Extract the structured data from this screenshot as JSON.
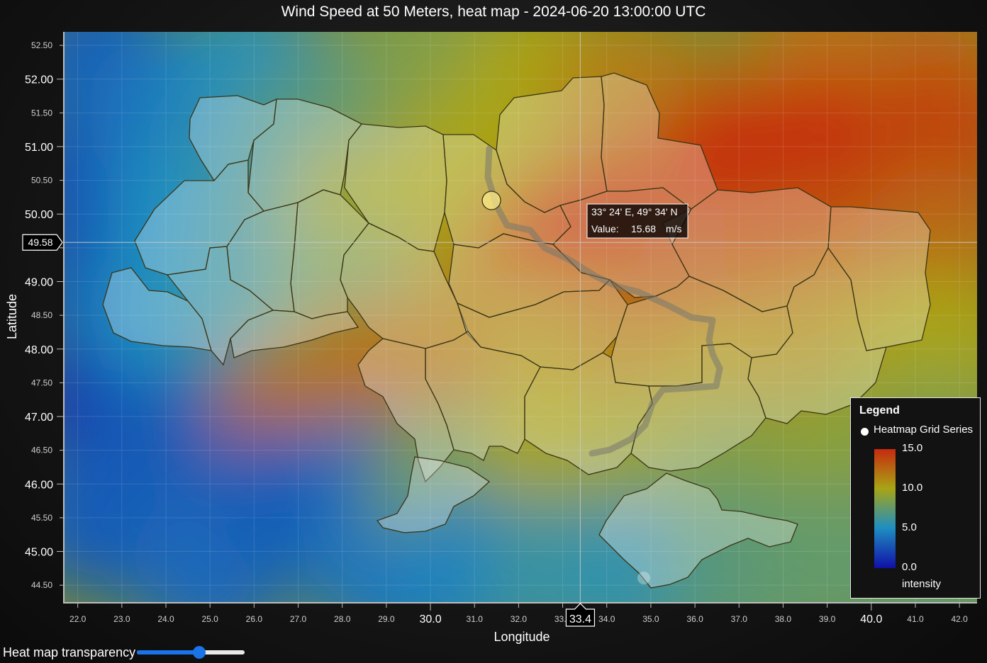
{
  "chart_data": {
    "type": "heatmap",
    "title": "Wind Speed at 50 Meters, heat map - 2024-06-20 13:00:00 UTC",
    "xlabel": "Longitude",
    "ylabel": "Latitude",
    "xlim": [
      21.7,
      42.4
    ],
    "ylim": [
      44.25,
      52.7
    ],
    "x_ticks": [
      "22.0",
      "23.0",
      "24.0",
      "25.0",
      "26.0",
      "27.0",
      "28.0",
      "29.0",
      "30.0",
      "31.0",
      "32.0",
      "33.0",
      "34.0",
      "35.0",
      "36.0",
      "37.0",
      "38.0",
      "39.0",
      "40.0",
      "41.0",
      "42.0"
    ],
    "x_major_ticks": [
      "30.0",
      "40.0"
    ],
    "y_ticks": [
      "44.50",
      "45.00",
      "45.50",
      "46.00",
      "46.50",
      "47.00",
      "47.50",
      "48.00",
      "48.50",
      "49.00",
      "49.50",
      "50.00",
      "50.50",
      "51.00",
      "51.50",
      "52.00",
      "52.50"
    ],
    "y_major_ticks": [
      "45.00",
      "46.00",
      "47.00",
      "48.00",
      "49.00",
      "50.00",
      "51.00",
      "52.00"
    ],
    "color_scale": {
      "min": 0.0,
      "max": 15.0,
      "stops": [
        {
          "value": 0.0,
          "color": "#1010a8"
        },
        {
          "value": 5.0,
          "color": "#1f8fc0"
        },
        {
          "value": 10.0,
          "color": "#a9a414"
        },
        {
          "value": 15.0,
          "color": "#c62a10"
        }
      ]
    },
    "intensity_field": [
      {
        "lon": 22.5,
        "lat": 52.3,
        "value": 3.0
      },
      {
        "lon": 22.3,
        "lat": 50.5,
        "value": 2.5
      },
      {
        "lon": 22.5,
        "lat": 49.0,
        "value": 2.5
      },
      {
        "lon": 22.5,
        "lat": 47.2,
        "value": 1.5
      },
      {
        "lon": 22.5,
        "lat": 45.5,
        "value": 3.0
      },
      {
        "lon": 24.0,
        "lat": 51.5,
        "value": 4.0
      },
      {
        "lon": 24.5,
        "lat": 50.0,
        "value": 5.0
      },
      {
        "lon": 24.0,
        "lat": 48.5,
        "value": 5.0
      },
      {
        "lon": 24.0,
        "lat": 46.5,
        "value": 3.0
      },
      {
        "lon": 25.0,
        "lat": 44.7,
        "value": 3.5
      },
      {
        "lon": 26.0,
        "lat": 52.0,
        "value": 5.0
      },
      {
        "lon": 26.5,
        "lat": 51.0,
        "value": 6.0
      },
      {
        "lon": 26.5,
        "lat": 49.5,
        "value": 6.5
      },
      {
        "lon": 26.0,
        "lat": 48.5,
        "value": 6.0
      },
      {
        "lon": 27.0,
        "lat": 47.0,
        "value": 12.5
      },
      {
        "lon": 27.0,
        "lat": 45.8,
        "value": 3.0
      },
      {
        "lon": 28.0,
        "lat": 51.5,
        "value": 7.0
      },
      {
        "lon": 28.5,
        "lat": 50.0,
        "value": 9.5
      },
      {
        "lon": 28.0,
        "lat": 48.5,
        "value": 8.0
      },
      {
        "lon": 28.5,
        "lat": 47.5,
        "value": 12.0
      },
      {
        "lon": 29.0,
        "lat": 46.0,
        "value": 3.5
      },
      {
        "lon": 29.0,
        "lat": 44.7,
        "value": 4.0
      },
      {
        "lon": 30.0,
        "lat": 52.3,
        "value": 8.5
      },
      {
        "lon": 31.0,
        "lat": 50.7,
        "value": 10.0
      },
      {
        "lon": 31.0,
        "lat": 48.5,
        "value": 11.0
      },
      {
        "lon": 30.5,
        "lat": 47.3,
        "value": 12.0
      },
      {
        "lon": 30.5,
        "lat": 46.0,
        "value": 8.0
      },
      {
        "lon": 31.0,
        "lat": 44.7,
        "value": 4.5
      },
      {
        "lon": 32.5,
        "lat": 52.0,
        "value": 10.0
      },
      {
        "lon": 33.0,
        "lat": 49.5,
        "value": 14.0
      },
      {
        "lon": 32.8,
        "lat": 48.0,
        "value": 11.0
      },
      {
        "lon": 33.0,
        "lat": 46.5,
        "value": 10.0
      },
      {
        "lon": 33.0,
        "lat": 44.7,
        "value": 6.0
      },
      {
        "lon": 34.5,
        "lat": 51.7,
        "value": 11.5
      },
      {
        "lon": 34.5,
        "lat": 49.8,
        "value": 14.5
      },
      {
        "lon": 35.0,
        "lat": 48.0,
        "value": 11.5
      },
      {
        "lon": 35.0,
        "lat": 46.3,
        "value": 9.5
      },
      {
        "lon": 35.0,
        "lat": 44.7,
        "value": 5.5
      },
      {
        "lon": 36.5,
        "lat": 51.0,
        "value": 12.5
      },
      {
        "lon": 37.0,
        "lat": 50.6,
        "value": 15.0
      },
      {
        "lon": 36.5,
        "lat": 49.0,
        "value": 13.0
      },
      {
        "lon": 37.0,
        "lat": 47.5,
        "value": 10.5
      },
      {
        "lon": 37.0,
        "lat": 46.0,
        "value": 8.5
      },
      {
        "lon": 37.0,
        "lat": 44.7,
        "value": 7.0
      },
      {
        "lon": 39.0,
        "lat": 52.3,
        "value": 12.0
      },
      {
        "lon": 39.0,
        "lat": 50.9,
        "value": 15.0
      },
      {
        "lon": 38.5,
        "lat": 49.5,
        "value": 13.5
      },
      {
        "lon": 39.0,
        "lat": 48.0,
        "value": 11.0
      },
      {
        "lon": 39.5,
        "lat": 46.5,
        "value": 9.0
      },
      {
        "lon": 39.0,
        "lat": 44.8,
        "value": 7.5
      },
      {
        "lon": 41.5,
        "lat": 52.0,
        "value": 12.5
      },
      {
        "lon": 41.5,
        "lat": 51.0,
        "value": 14.0
      },
      {
        "lon": 41.5,
        "lat": 49.5,
        "value": 12.5
      },
      {
        "lon": 41.5,
        "lat": 48.0,
        "value": 10.0
      },
      {
        "lon": 41.5,
        "lat": 46.5,
        "value": 8.5
      },
      {
        "lon": 41.5,
        "lat": 44.7,
        "value": 7.5
      }
    ],
    "crosshair": {
      "lon": 33.4,
      "lat": 49.58,
      "x_label": "33.4",
      "y_label": "49.58"
    },
    "tooltip": {
      "coords": "33° 24' E, 49° 34' N",
      "value_label": "Value:",
      "value": "15.68",
      "unit": "m/s"
    },
    "grid": true
  },
  "legend": {
    "title": "Legend",
    "series_name": "Heatmap Grid Series",
    "max_label": "15.0",
    "mid_high_label": "10.0",
    "mid_low_label": "5.0",
    "min_label": "0.0",
    "unit": "intensity"
  },
  "controls": {
    "transparency_label": "Heat map transparency",
    "transparency_value": 0.58
  }
}
